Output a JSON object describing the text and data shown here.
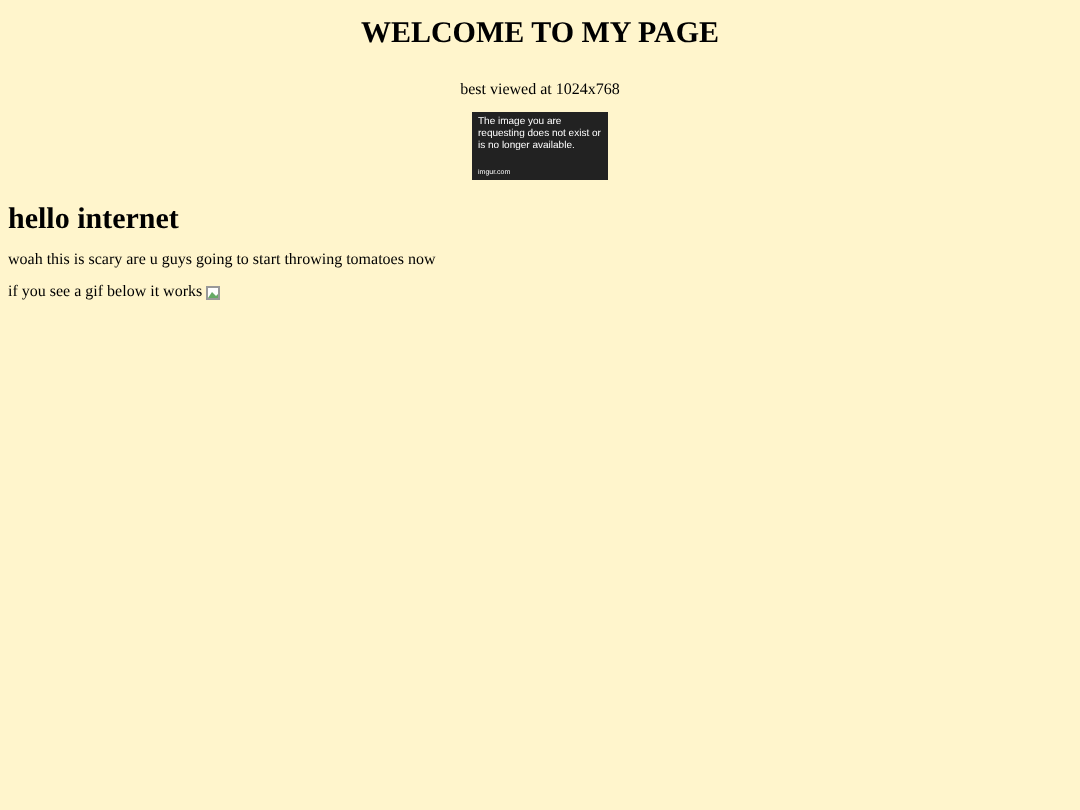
{
  "header": {
    "title": "WELCOME TO MY PAGE",
    "subtitle": "best viewed at 1024x768"
  },
  "removed_image": {
    "message": "The image you are requesting does not exist or is no longer available.",
    "source": "imgur.com"
  },
  "content": {
    "heading": "hello internet",
    "paragraphs": [
      "woah this is scary are u guys going to start throwing tomatoes now",
      "if you see a gif below it works"
    ]
  }
}
